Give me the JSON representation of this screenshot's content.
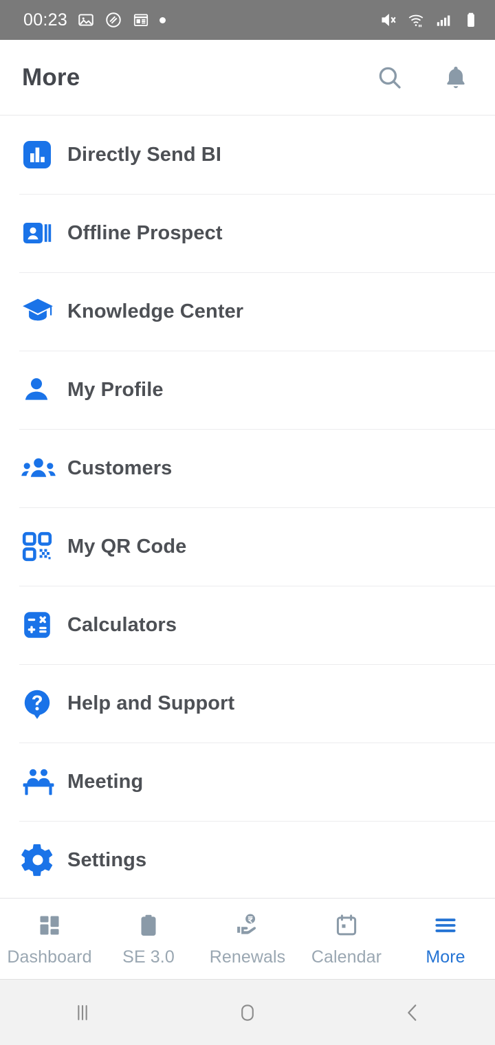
{
  "status_bar": {
    "time": "00:23",
    "left_icons": [
      "image-icon",
      "layers-icon",
      "news-icon",
      "dot-indicator"
    ],
    "right_icons": [
      "volume-muted-icon",
      "wifi-icon",
      "cellular-signal-icon",
      "battery-icon"
    ],
    "background": "#7a7a7a"
  },
  "appbar": {
    "title": "More",
    "actions": [
      {
        "name": "search-icon",
        "label": "Search"
      },
      {
        "name": "notifications-bell-icon",
        "label": "Notifications"
      }
    ]
  },
  "colors": {
    "accent_blue": "#1a73e8",
    "nav_active": "#2574d4",
    "nav_inactive": "#9aa7b2",
    "label_text": "#4d5055",
    "divider": "#ececee"
  },
  "menu": {
    "items": [
      {
        "label": "Directly Send BI",
        "icon": "bar-chart-square-icon"
      },
      {
        "label": "Offline Prospect",
        "icon": "contact-card-icon"
      },
      {
        "label": "Knowledge Center",
        "icon": "graduation-cap-icon"
      },
      {
        "label": "My Profile",
        "icon": "person-icon"
      },
      {
        "label": "Customers",
        "icon": "people-group-icon"
      },
      {
        "label": "My QR Code",
        "icon": "qr-code-icon"
      },
      {
        "label": "Calculators",
        "icon": "calculator-icon"
      },
      {
        "label": "Help and Support",
        "icon": "question-bubble-icon"
      },
      {
        "label": "Meeting",
        "icon": "meeting-table-icon"
      },
      {
        "label": "Settings",
        "icon": "gear-icon"
      }
    ]
  },
  "bottom_nav": {
    "items": [
      {
        "label": "Dashboard",
        "icon": "dashboard-grid-icon",
        "active": false
      },
      {
        "label": "SE 3.0",
        "icon": "clipboard-icon",
        "active": false
      },
      {
        "label": "Renewals",
        "icon": "hand-rupee-icon",
        "active": false
      },
      {
        "label": "Calendar",
        "icon": "calendar-icon",
        "active": false
      },
      {
        "label": "More",
        "icon": "hamburger-menu-icon",
        "active": true
      }
    ]
  },
  "system_nav": {
    "buttons": [
      {
        "name": "recents-button",
        "icon": "recents-bars-icon"
      },
      {
        "name": "home-button",
        "icon": "home-square-icon"
      },
      {
        "name": "back-button",
        "icon": "back-chevron-icon"
      }
    ]
  }
}
